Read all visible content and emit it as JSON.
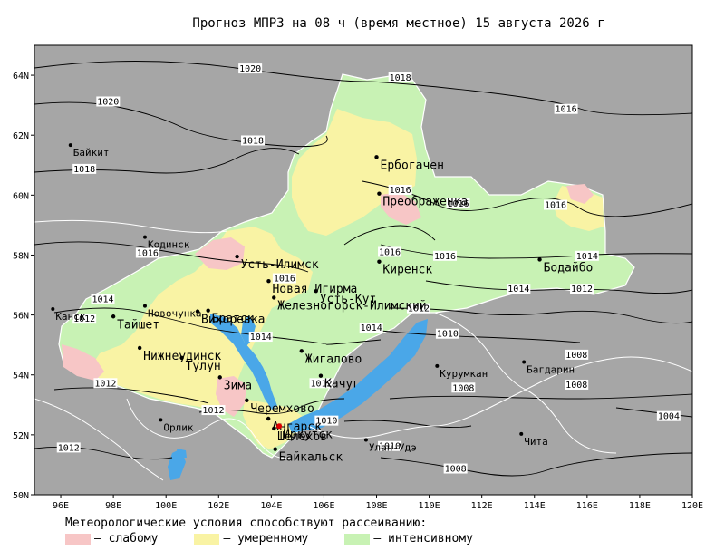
{
  "title": "Прогноз МПРЗ на 08 ч (время местное) 15 августа 2026 г",
  "legend": {
    "heading": "Метеорологические условия способствуют рассеиванию:",
    "items": [
      {
        "label": "— слабому",
        "color": "#f7c6c6"
      },
      {
        "label": "— умеренному",
        "color": "#f9f3a4"
      },
      {
        "label": "— интенсивному",
        "color": "#c8f2b4"
      }
    ]
  },
  "colors": {
    "background": "#a6a6a6",
    "weak": "#f7c6c6",
    "moderate": "#f9f3a4",
    "intensive": "#c8f2b4",
    "water": "#4aa7e8",
    "isobar": "#000000",
    "boundary": "#ffffff",
    "highlight_city": "#e00000"
  },
  "axes": {
    "lat_labels": [
      "64N",
      "62N",
      "60N",
      "58N",
      "56N",
      "54N",
      "52N",
      "50N"
    ],
    "lon_labels": [
      "96E",
      "98E",
      "100E",
      "102E",
      "104E",
      "106E",
      "108E",
      "110E",
      "112E",
      "114E",
      "116E",
      "118E",
      "120E"
    ]
  },
  "cities": [
    {
      "name": "Ербогачен",
      "lat": 61.27,
      "lon": 108.0
    },
    {
      "name": "Преображенка",
      "lat": 60.05,
      "lon": 108.1
    },
    {
      "name": "Усть-Илимск",
      "lat": 57.95,
      "lon": 102.7
    },
    {
      "name": "Новая Игирма",
      "lat": 57.13,
      "lon": 103.9
    },
    {
      "name": "Усть-Кут",
      "lat": 56.8,
      "lon": 105.7
    },
    {
      "name": "Киренск",
      "lat": 57.78,
      "lon": 108.1
    },
    {
      "name": "Бодайбо",
      "lat": 57.85,
      "lon": 114.2
    },
    {
      "name": "Железногорск-Илимский",
      "lat": 56.58,
      "lon": 104.1
    },
    {
      "name": "Братск",
      "lat": 56.15,
      "lon": 101.6
    },
    {
      "name": "Вихоревка",
      "lat": 56.12,
      "lon": 101.2
    },
    {
      "name": "Тайшет",
      "lat": 55.95,
      "lon": 98.0
    },
    {
      "name": "Нижнеудинск",
      "lat": 54.9,
      "lon": 99.0
    },
    {
      "name": "Тулун",
      "lat": 54.57,
      "lon": 100.6
    },
    {
      "name": "Жигалово",
      "lat": 54.8,
      "lon": 105.15
    },
    {
      "name": "Зима",
      "lat": 53.92,
      "lon": 102.05
    },
    {
      "name": "Черемхово",
      "lat": 53.15,
      "lon": 103.07
    },
    {
      "name": "Качуг",
      "lat": 53.97,
      "lon": 105.88
    },
    {
      "name": "Ангарск",
      "lat": 52.54,
      "lon": 103.89
    },
    {
      "name": "Шелехов",
      "lat": 52.21,
      "lon": 104.1
    },
    {
      "name": "Иркутск",
      "lat": 52.29,
      "lon": 104.3
    },
    {
      "name": "Байкальск",
      "lat": 51.52,
      "lon": 104.15
    }
  ],
  "outer_cities": [
    {
      "name": "Байкит",
      "lat": 61.67,
      "lon": 96.37
    },
    {
      "name": "Кодинск",
      "lat": 58.6,
      "lon": 99.2
    },
    {
      "name": "Новочунка",
      "lat": 56.3,
      "lon": 99.2
    },
    {
      "name": "Канск",
      "lat": 56.2,
      "lon": 95.7
    },
    {
      "name": "Орлик",
      "lat": 52.5,
      "lon": 99.8
    },
    {
      "name": "Курумкан",
      "lat": 54.3,
      "lon": 110.3
    },
    {
      "name": "Багдарин",
      "lat": 54.43,
      "lon": 113.6
    },
    {
      "name": "Чита",
      "lat": 52.03,
      "lon": 113.5
    },
    {
      "name": "Улан-Удэ",
      "lat": 51.83,
      "lon": 107.6
    }
  ],
  "isobar_labels": [
    {
      "text": "1020",
      "lat": 64.15,
      "lon": 103.2
    },
    {
      "text": "1020",
      "lat": 63.05,
      "lon": 97.8
    },
    {
      "text": "1018",
      "lat": 63.85,
      "lon": 108.9
    },
    {
      "text": "1016",
      "lat": 62.8,
      "lon": 115.2
    },
    {
      "text": "1018",
      "lat": 61.75,
      "lon": 103.3
    },
    {
      "text": "1018",
      "lat": 60.8,
      "lon": 96.9
    },
    {
      "text": "1016",
      "lat": 60.1,
      "lon": 108.9
    },
    {
      "text": "1016",
      "lat": 59.65,
      "lon": 111.1
    },
    {
      "text": "1016",
      "lat": 59.6,
      "lon": 114.8
    },
    {
      "text": "1016",
      "lat": 58.03,
      "lon": 108.5
    },
    {
      "text": "1016",
      "lat": 57.9,
      "lon": 110.6
    },
    {
      "text": "1016",
      "lat": 58.0,
      "lon": 99.3
    },
    {
      "text": "1016",
      "lat": 57.15,
      "lon": 104.5
    },
    {
      "text": "1014",
      "lat": 57.9,
      "lon": 116.0
    },
    {
      "text": "1014",
      "lat": 56.8,
      "lon": 113.4
    },
    {
      "text": "1012",
      "lat": 56.8,
      "lon": 115.8
    },
    {
      "text": "1012",
      "lat": 56.15,
      "lon": 109.6
    },
    {
      "text": "1014",
      "lat": 56.45,
      "lon": 97.6
    },
    {
      "text": "1012",
      "lat": 55.8,
      "lon": 96.9
    },
    {
      "text": "1014",
      "lat": 55.5,
      "lon": 107.8
    },
    {
      "text": "1014",
      "lat": 55.2,
      "lon": 103.6
    },
    {
      "text": "1010",
      "lat": 55.3,
      "lon": 110.7
    },
    {
      "text": "1012",
      "lat": 53.65,
      "lon": 97.7
    },
    {
      "text": "1008",
      "lat": 54.6,
      "lon": 115.6
    },
    {
      "text": "1012",
      "lat": 52.75,
      "lon": 101.8
    },
    {
      "text": "1012",
      "lat": 53.65,
      "lon": 105.9
    },
    {
      "text": "1008",
      "lat": 53.5,
      "lon": 111.3
    },
    {
      "text": "1008",
      "lat": 53.6,
      "lon": 115.6
    },
    {
      "text": "1010",
      "lat": 52.4,
      "lon": 106.1
    },
    {
      "text": "1004",
      "lat": 52.55,
      "lon": 119.1
    },
    {
      "text": "1010",
      "lat": 51.55,
      "lon": 108.5
    },
    {
      "text": "1012",
      "lat": 51.5,
      "lon": 96.3
    },
    {
      "text": "1008",
      "lat": 50.8,
      "lon": 111.0
    }
  ]
}
